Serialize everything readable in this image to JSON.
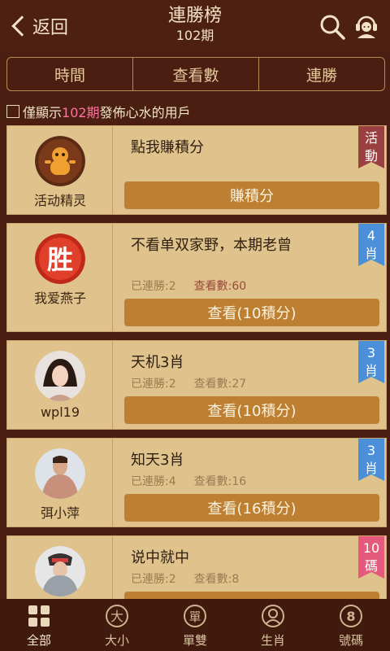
{
  "header": {
    "back_label": "返回",
    "title": "連勝榜",
    "subtitle": "102期"
  },
  "tabs": [
    {
      "label": "時間"
    },
    {
      "label": "查看數"
    },
    {
      "label": "連勝"
    }
  ],
  "filter": {
    "prefix": "僅顯示",
    "highlight": "102期",
    "suffix": "發佈心水的用戶",
    "checked": false
  },
  "cards": [
    {
      "username": "活动精灵",
      "title": "點我賺積分",
      "badge": "活\n動",
      "badge_color": "#9a4040",
      "button": "賺積分",
      "stats": null
    },
    {
      "username": "我爱燕子",
      "title": "不看单双家野，本期老曾",
      "badge": "4\n肖",
      "badge_color": "#4a8fd8",
      "streak_label": "已連勝:2",
      "views_label": "查看數:60",
      "button": "查看(10積分)"
    },
    {
      "username": "wpl19",
      "title": "天机3肖",
      "badge": "3\n肖",
      "badge_color": "#4a8fd8",
      "streak_label": "已連勝:2",
      "views_label": "查看數:27",
      "button": "查看(10積分)"
    },
    {
      "username": "弭小萍",
      "title": "知天3肖",
      "badge": "3\n肖",
      "badge_color": "#4a8fd8",
      "streak_label": "已連勝:4",
      "views_label": "查看數:16",
      "button": "查看(16積分)"
    },
    {
      "username": "",
      "title": "说中就中",
      "badge": "10\n碼",
      "badge_color": "#e35a7a",
      "streak_label": "已連勝:2",
      "views_label": "查看數:8",
      "button": ""
    }
  ],
  "bottom_nav": [
    {
      "label": "全部",
      "icon": "grid-icon",
      "active": true
    },
    {
      "label": "大小",
      "icon": "da-circle-icon",
      "glyph": "大"
    },
    {
      "label": "單雙",
      "icon": "dan-circle-icon",
      "glyph": "單"
    },
    {
      "label": "生肖",
      "icon": "zodiac-icon"
    },
    {
      "label": "號碼",
      "icon": "number-8-icon",
      "glyph": "8"
    }
  ],
  "colors": {
    "background": "#4a1f12",
    "card": "#dfc28c",
    "button": "#bd8032",
    "highlight": "#ff6fa0"
  }
}
